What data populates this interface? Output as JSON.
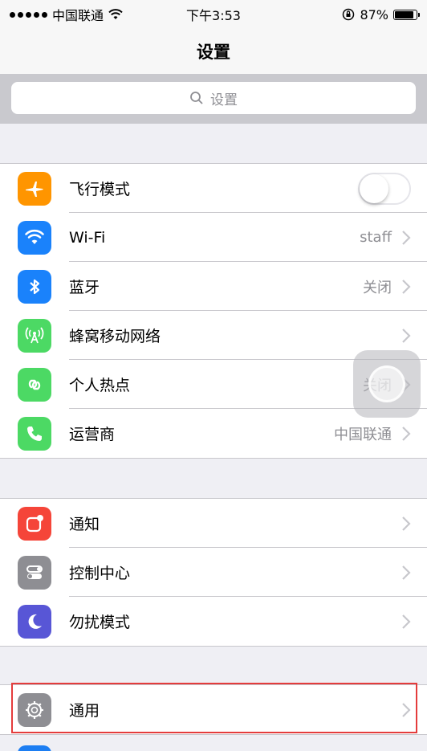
{
  "status_bar": {
    "carrier": "中国联通",
    "time": "下午3:53",
    "battery": "87%",
    "battery_level": 0.87
  },
  "nav": {
    "title": "设置"
  },
  "search": {
    "placeholder": "设置"
  },
  "groups": [
    {
      "rows": [
        {
          "label": "飞行模式",
          "icon": "airplane-icon",
          "color": "#ff9500",
          "toggle": false
        },
        {
          "label": "Wi-Fi",
          "value": "staff",
          "icon": "wifi-icon",
          "color": "#1a82fb"
        },
        {
          "label": "蓝牙",
          "value": "关闭",
          "icon": "bluetooth-icon",
          "color": "#1a82fb"
        },
        {
          "label": "蜂窝移动网络",
          "icon": "cellular-icon",
          "color": "#4cd964"
        },
        {
          "label": "个人热点",
          "value": "关闭",
          "icon": "hotspot-icon",
          "color": "#4cd964"
        },
        {
          "label": "运营商",
          "value": "中国联通",
          "icon": "phone-icon",
          "color": "#4cd964"
        }
      ]
    },
    {
      "rows": [
        {
          "label": "通知",
          "icon": "notifications-icon",
          "color": "#f54539"
        },
        {
          "label": "控制中心",
          "icon": "control-center-icon",
          "color": "#8e8e93"
        },
        {
          "label": "勿扰模式",
          "icon": "moon-icon",
          "color": "#5856d6"
        }
      ]
    },
    {
      "rows": [
        {
          "label": "通用",
          "icon": "gear-icon",
          "color": "#8e8e93"
        }
      ]
    }
  ]
}
